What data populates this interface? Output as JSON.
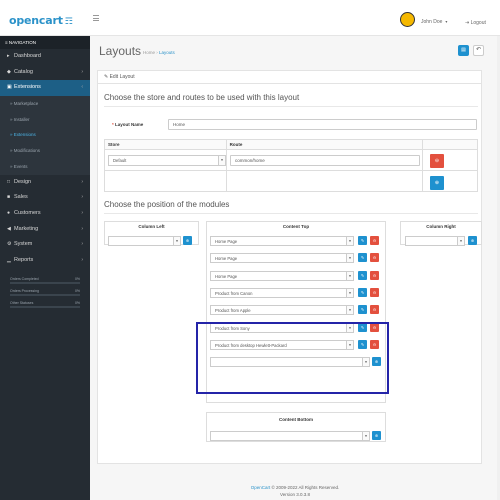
{
  "header": {
    "logo_text": "opencart",
    "logo_cart": "☶",
    "user_name": "John Doe",
    "user_caret": "▾",
    "logout_label": "⇥ Logout"
  },
  "sidebar": {
    "nav_header": "≡ NAVIGATION",
    "items_top": [
      {
        "icon": "▸",
        "label": "Dashboard",
        "arrow": ""
      },
      {
        "icon": "◆",
        "label": "Catalog",
        "arrow": "›"
      },
      {
        "icon": "▣",
        "label": "Extensions",
        "arrow": "‹"
      }
    ],
    "sub_items": [
      "» Marketplace",
      "» Installer",
      "» Extensions",
      "» Modifications",
      "» Events"
    ],
    "items_bottom": [
      {
        "icon": "□",
        "label": "Design",
        "arrow": "›"
      },
      {
        "icon": "■",
        "label": "Sales",
        "arrow": "›"
      },
      {
        "icon": "●",
        "label": "Customers",
        "arrow": "›"
      },
      {
        "icon": "◀",
        "label": "Marketing",
        "arrow": "›"
      },
      {
        "icon": "⚙",
        "label": "System",
        "arrow": "›"
      },
      {
        "icon": "▁",
        "label": "Reports",
        "arrow": "›"
      }
    ],
    "progress": [
      {
        "label": "Orders Completed",
        "value": "0%",
        "fraction": 0
      },
      {
        "label": "Orders Processing",
        "value": "0%",
        "fraction": 0
      },
      {
        "label": "Other Statuses",
        "value": "0%",
        "fraction": 0
      }
    ]
  },
  "main": {
    "title": "Layouts",
    "breadcrumb_home": "Home",
    "breadcrumb_sep": "›",
    "breadcrumb_current": "Layouts",
    "save_icon": "▤",
    "back_icon": "↶",
    "panel_heading": "✎ Edit Layout",
    "section1_title": "Choose the store and routes to be used with this layout",
    "layout_name_label": "Layout Name",
    "layout_name_value": "Home",
    "route_table": {
      "headers": [
        "Store",
        "Route"
      ],
      "store_value": "Default",
      "route_value": "common/home"
    },
    "section2_title": "Choose the position of the modules",
    "column_left": "Column Left",
    "content_top": "Content Top",
    "column_right": "Column Right",
    "content_bottom": "Content Bottom",
    "content_top_modules": [
      "Home Page",
      "Home Page",
      "Home Page",
      "Product from Canon",
      "Product from Apple",
      "Product from Sony",
      "Product from desktop Hewlett-Packard"
    ]
  },
  "footer": {
    "link": "OpenCart",
    "copyright": " © 2009-2022 All Rights Reserved.",
    "version": "Version 3.0.3.8"
  },
  "colors": {
    "accent": "#1e91cf",
    "danger": "#e3503e",
    "sidebar": "#252c33",
    "highlight": "#2424a8"
  }
}
